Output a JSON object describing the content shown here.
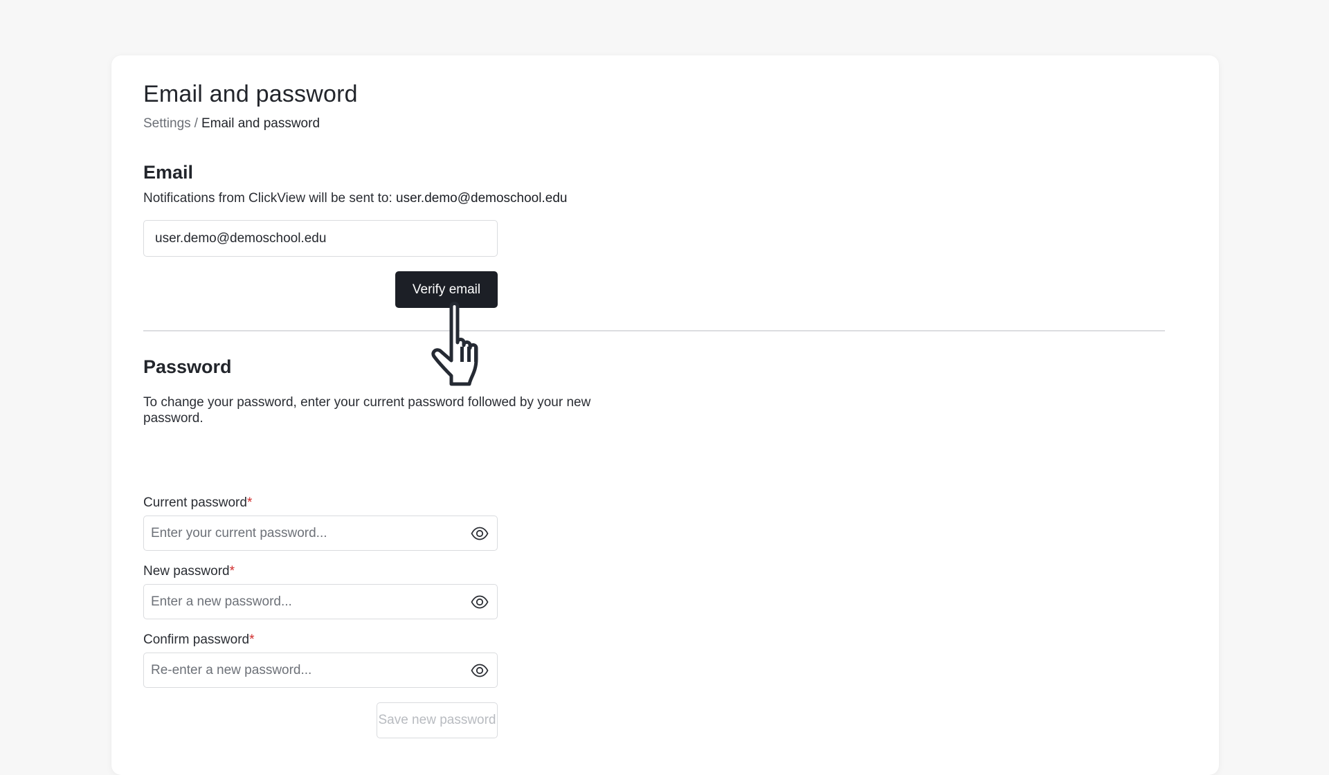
{
  "page": {
    "title": "Email and password",
    "breadcrumb": {
      "parent": "Settings",
      "separator": "/",
      "current": "Email and password"
    }
  },
  "email_section": {
    "title": "Email",
    "note_prefix": "Notifications from ClickView will be sent to:",
    "note_email": "user.demo@demoschool.edu",
    "field_value": "user.demo@demoschool.edu",
    "verify_label": "Verify email"
  },
  "password_section": {
    "title": "Password",
    "description": "To change your password, enter your current password followed by your new password.",
    "required_marker": "*",
    "current": {
      "label": "Current password",
      "placeholder": "Enter your current password..."
    },
    "new": {
      "label": "New password",
      "placeholder": "Enter a new password..."
    },
    "confirm": {
      "label": "Confirm password",
      "placeholder": "Re-enter a new password..."
    },
    "save_label": "Save new password"
  },
  "icons": {
    "visibility": "eye-icon",
    "cursor": "hand-pointer-cursor"
  },
  "colors": {
    "primary_button": "#1c1f26",
    "required": "#d02b2b",
    "disabled_text": "#b8bbc0"
  }
}
